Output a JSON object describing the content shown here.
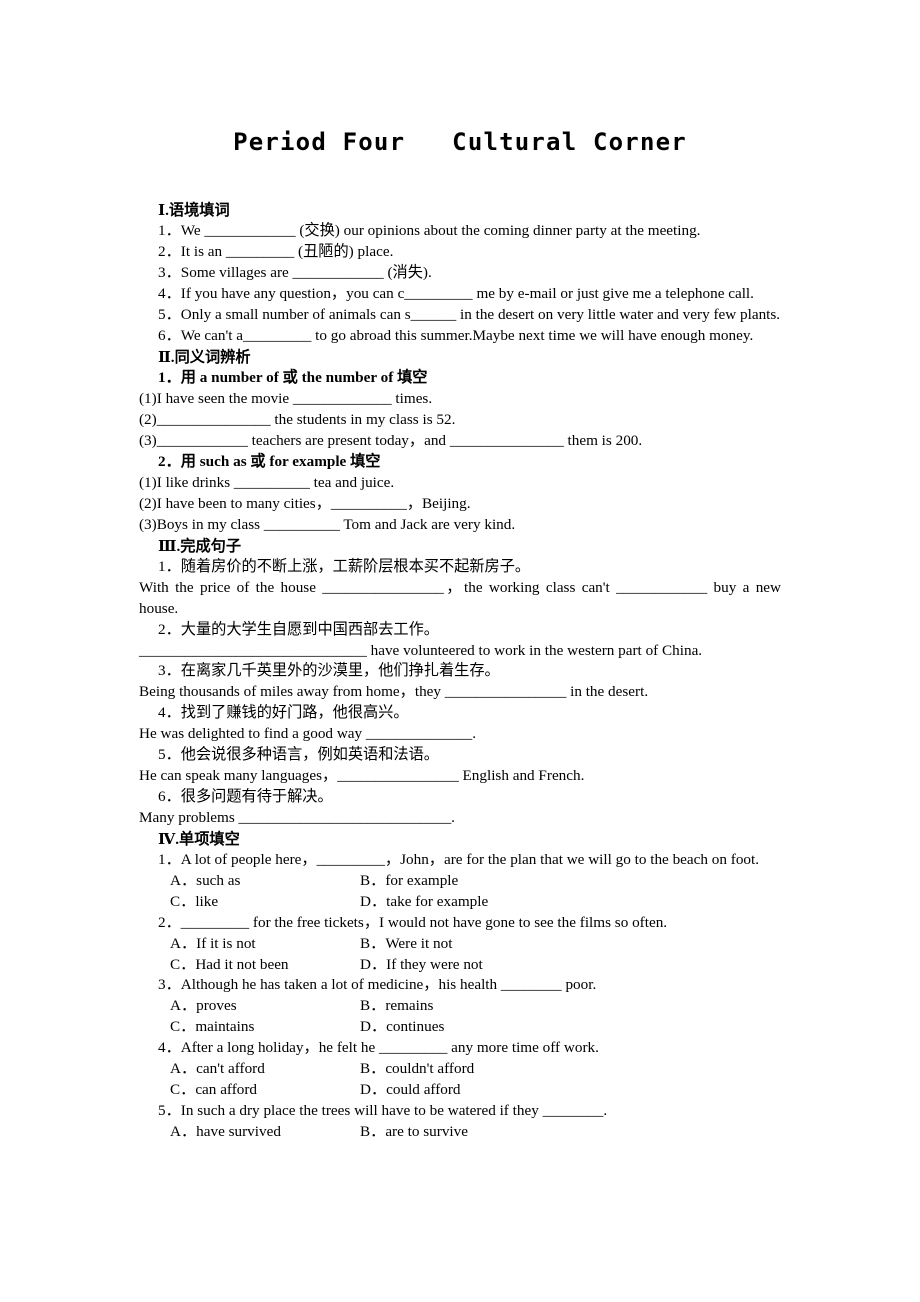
{
  "title": "Period Four   Cultural Corner",
  "sections": [
    {
      "id": "section-1",
      "roman": "Ⅰ",
      "heading": "Ⅰ.语境填词",
      "lines": [
        {
          "kind": "item",
          "indent": true,
          "justify": false,
          "text": "1．We ____________ (交换) our opinions about the coming dinner party at the meeting."
        },
        {
          "kind": "item",
          "indent": true,
          "justify": false,
          "text": "2．It is an _________ (丑陋的) place."
        },
        {
          "kind": "item",
          "indent": true,
          "justify": false,
          "text": "3．Some villages are ____________ (消失)."
        },
        {
          "kind": "item",
          "indent": true,
          "justify": false,
          "text": "4．If you have any question，you can c_________ me by e-mail or just give me a telephone call."
        },
        {
          "kind": "item",
          "indent": true,
          "justify": true,
          "text": "5．Only a small number of animals can s______ in the desert on very little water and very few plants."
        },
        {
          "kind": "item",
          "indent": true,
          "justify": true,
          "text": "6．We can't a_________ to go abroad this summer.Maybe next time we will have enough money."
        }
      ]
    },
    {
      "id": "section-2",
      "roman": "Ⅱ",
      "heading": "Ⅱ.同义词辨析",
      "lines": [
        {
          "kind": "subhead",
          "indent": true,
          "justify": false,
          "text": "1．用 a number of 或 the number of 填空"
        },
        {
          "kind": "item",
          "indent": false,
          "justify": false,
          "text": "(1)I have seen the movie _____________ times."
        },
        {
          "kind": "item",
          "indent": false,
          "justify": false,
          "text": "(2)_______________ the students in my class is 52."
        },
        {
          "kind": "item",
          "indent": false,
          "justify": false,
          "text": "(3)____________ teachers are present today，and _______________ them is 200."
        },
        {
          "kind": "subhead",
          "indent": true,
          "justify": false,
          "text": "2．用 such as 或 for example 填空"
        },
        {
          "kind": "item",
          "indent": false,
          "justify": false,
          "text": "(1)I like drinks __________ tea and juice."
        },
        {
          "kind": "item",
          "indent": false,
          "justify": false,
          "text": "(2)I have been to many cities，__________，Beijing."
        },
        {
          "kind": "item",
          "indent": false,
          "justify": false,
          "text": "(3)Boys in my class __________ Tom and Jack are very kind."
        }
      ]
    },
    {
      "id": "section-3",
      "roman": "Ⅲ",
      "heading": "Ⅲ.完成句子",
      "lines": [
        {
          "kind": "item",
          "indent": true,
          "justify": false,
          "text": "1．随着房价的不断上涨，工薪阶层根本买不起新房子。"
        },
        {
          "kind": "item",
          "indent": false,
          "justify": true,
          "text": "With the price of the house ________________，the working class can't ____________ buy a new house."
        },
        {
          "kind": "item",
          "indent": true,
          "justify": false,
          "text": "2．大量的大学生自愿到中国西部去工作。"
        },
        {
          "kind": "item",
          "indent": false,
          "justify": false,
          "text": "______________________________ have volunteered to work in the western part of China."
        },
        {
          "kind": "item",
          "indent": true,
          "justify": false,
          "text": "3．在离家几千英里外的沙漠里，他们挣扎着生存。"
        },
        {
          "kind": "item",
          "indent": false,
          "justify": false,
          "text": "Being thousands of miles away from home，they ________________ in the desert."
        },
        {
          "kind": "item",
          "indent": true,
          "justify": false,
          "text": "4．找到了赚钱的好门路，他很高兴。"
        },
        {
          "kind": "item",
          "indent": false,
          "justify": false,
          "text": "He was delighted to find a good way ______________."
        },
        {
          "kind": "item",
          "indent": true,
          "justify": false,
          "text": "5．他会说很多种语言，例如英语和法语。"
        },
        {
          "kind": "item",
          "indent": false,
          "justify": false,
          "text": "He can speak many languages，________________ English and French."
        },
        {
          "kind": "item",
          "indent": true,
          "justify": false,
          "text": "6．很多问题有待于解决。"
        },
        {
          "kind": "item",
          "indent": false,
          "justify": false,
          "text": "Many problems ____________________________."
        }
      ]
    },
    {
      "id": "section-4",
      "roman": "Ⅳ",
      "heading": "Ⅳ.单项填空",
      "questions": [
        {
          "stem": "1．A lot of people here，_________，John，are for the plan that we will go to the beach on foot.",
          "justify": true,
          "options": [
            {
              "a": "A．such as",
              "b": "B．for example"
            },
            {
              "a": "C．like",
              "b": "D．take for example"
            }
          ]
        },
        {
          "stem": "2．_________ for the free tickets，I would not have gone to see the films so often.",
          "justify": false,
          "options": [
            {
              "a": "A．If it is not",
              "b": "B．Were it not"
            },
            {
              "a": "C．Had it not been",
              "b": "D．If they were not"
            }
          ]
        },
        {
          "stem": "3．Although he has taken a lot of medicine，his health ________ poor.",
          "justify": false,
          "options": [
            {
              "a": "A．proves",
              "b": "B．remains"
            },
            {
              "a": "C．maintains",
              "b": "D．continues"
            }
          ]
        },
        {
          "stem": "4．After a long holiday，he felt he _________ any more time off work.",
          "justify": false,
          "options": [
            {
              "a": "A．can't afford",
              "b": "B．couldn't afford"
            },
            {
              "a": "C．can afford",
              "b": "D．could afford"
            }
          ]
        },
        {
          "stem": "5．In such a dry place the trees will have to be watered if they ________.",
          "justify": false,
          "options": [
            {
              "a": "A．have survived",
              "b": "B．are to survive"
            }
          ]
        }
      ]
    }
  ]
}
